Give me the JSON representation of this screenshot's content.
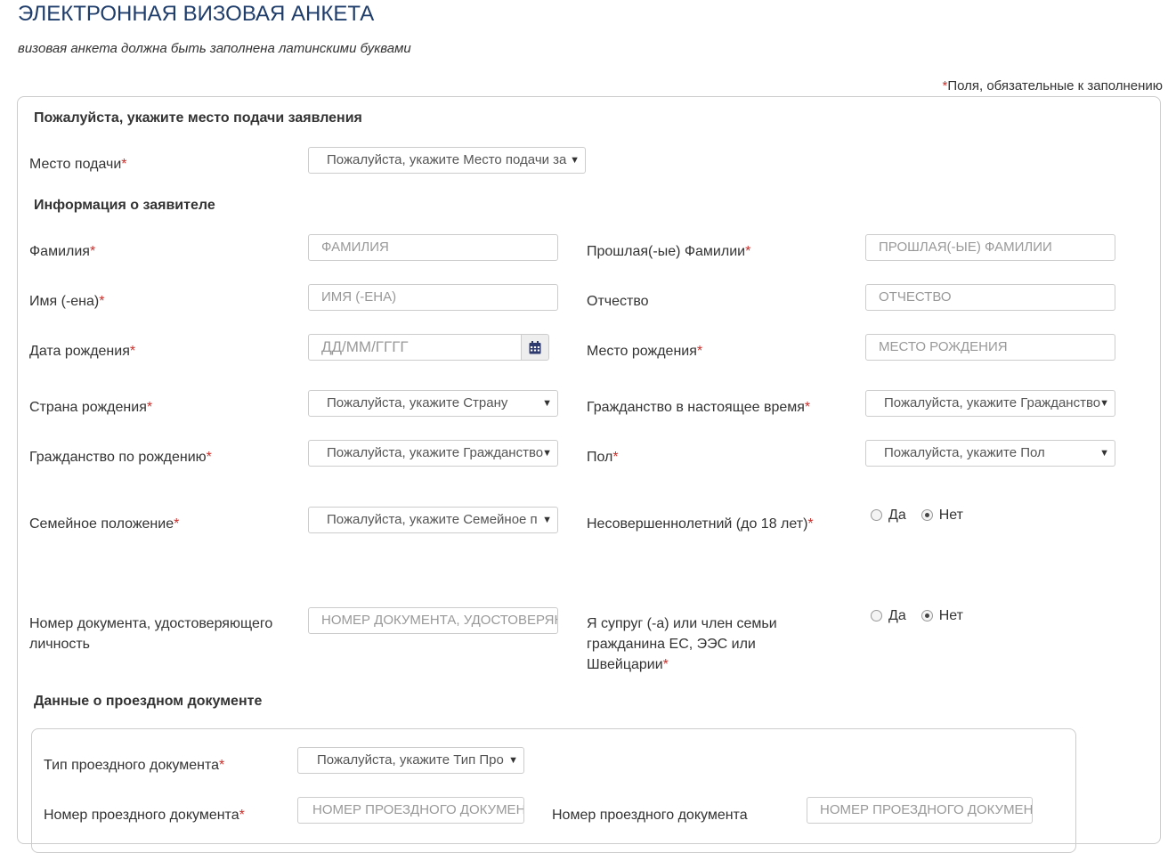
{
  "page": {
    "title": "ЭЛЕКТРОННАЯ ВИЗОВАЯ АНКЕТА",
    "subtitle": "визовая анкета должна быть заполнена латинскими буквами",
    "required_mark": "*",
    "required_note": "Поля, обязательные к заполнению",
    "colors": {
      "title": "#1f3d6b",
      "required": "#c9302c",
      "border": "#cccccc"
    }
  },
  "submission": {
    "heading": "Пожалуйста, укажите место подачи заявления",
    "place_label": "Место подачи",
    "place_value": "Пожалуйста, укажите Место подачи за"
  },
  "applicant": {
    "heading": "Информация о заявителе",
    "surname": {
      "label": "Фамилия",
      "placeholder": "ФАМИЛИЯ"
    },
    "former_surnames": {
      "label": "Прошлая(-ые) Фамилии",
      "placeholder": "ПРОШЛАЯ(-ЫЕ) ФАМИЛИИ"
    },
    "first_name": {
      "label": "Имя (-ена)",
      "placeholder": "ИМЯ (-ЕНА)"
    },
    "patronymic": {
      "label": "Отчество",
      "placeholder": "ОТЧЕСТВО"
    },
    "birth_date": {
      "label": "Дата рождения",
      "placeholder": "ДД/ММ/ГГГГ",
      "icon": "calendar-icon"
    },
    "birth_place": {
      "label": "Место рождения",
      "placeholder": "МЕСТО РОЖДЕНИЯ"
    },
    "birth_country": {
      "label": "Страна рождения",
      "value": "Пожалуйста, укажите Страну"
    },
    "current_citizenship": {
      "label": "Гражданство в настоящее время",
      "value": "Пожалуйста, укажите Гражданство"
    },
    "birth_citizenship": {
      "label": "Гражданство по рождению",
      "value": "Пожалуйста, укажите Гражданство"
    },
    "sex": {
      "label": "Пол",
      "value": "Пожалуйста, укажите Пол"
    },
    "marital_status": {
      "label": "Семейное положение",
      "value": "Пожалуйста, укажите Семейное п"
    },
    "minor": {
      "label": "Несовершеннолетний (до 18 лет)",
      "yes": "Да",
      "no": "Нет",
      "selected": "Нет"
    },
    "id_number": {
      "label": "Номер документа, удостоверяющего личность",
      "placeholder": "НОМЕР ДОКУМЕНТА, УДОСТОВЕРЯЮЩЕГО ЛИЧНОСТЬ"
    },
    "eu_family": {
      "label": "Я супруг (-а) или член семьи гражданина ЕС, ЭЭС или Швейцарии",
      "yes": "Да",
      "no": "Нет",
      "selected": "Нет"
    }
  },
  "travel_document": {
    "heading": "Данные о проездном документе",
    "type": {
      "label": "Тип проездного документа",
      "value": "Пожалуйста, укажите Тип Про"
    },
    "number": {
      "label": "Номер проездного документа",
      "placeholder": "НОМЕР ПРОЕЗДНОГО ДОКУМЕНТА"
    },
    "number_confirm": {
      "label": "Номер проездного документа",
      "placeholder": "НОМЕР ПРОЕЗДНОГО ДОКУМЕНТА"
    }
  }
}
